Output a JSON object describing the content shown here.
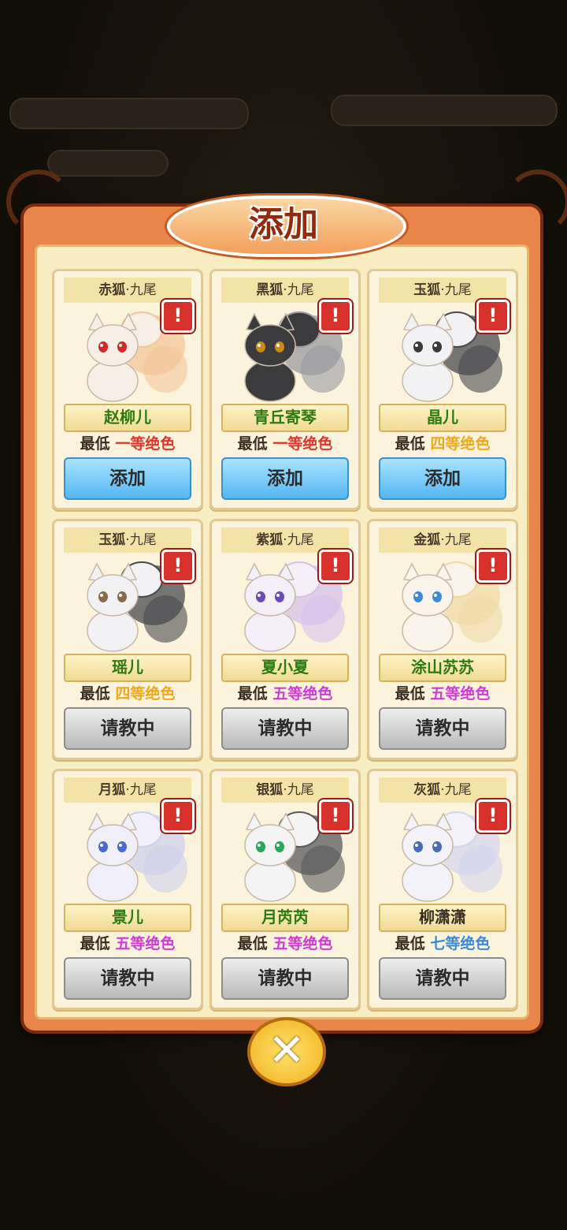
{
  "dialog": {
    "title": "添加"
  },
  "cards": [
    {
      "type_prefix": "赤狐",
      "type_suffix": "·九尾",
      "type_color": "#3a2e22",
      "name": "赵柳儿",
      "name_color": "#2e7a12",
      "req_prefix": "最低",
      "req_rank": "一等绝色",
      "req_color": "#e2342a",
      "button": "添加",
      "button_state": "add",
      "fur": "#f7eee6",
      "accent": "#f3c79a",
      "eye": "#d12a2a"
    },
    {
      "type_prefix": "黑狐",
      "type_suffix": "·九尾",
      "type_color": "#3a2e22",
      "name": "青丘寄琴",
      "name_color": "#2e7a12",
      "req_prefix": "最低",
      "req_rank": "一等绝色",
      "req_color": "#e2342a",
      "button": "添加",
      "button_state": "add",
      "fur": "#3b3b3e",
      "accent": "#9a9aa0",
      "eye": "#c98a1a"
    },
    {
      "type_prefix": "玉狐",
      "type_suffix": "·九尾",
      "type_color": "#3a2e22",
      "name": "晶儿",
      "name_color": "#2e7a12",
      "req_prefix": "最低",
      "req_rank": "四等绝色",
      "req_color": "#f0a81a",
      "button": "添加",
      "button_state": "add",
      "fur": "#f2f2f4",
      "accent": "#4a4a4e",
      "eye": "#3a3a3a"
    },
    {
      "type_prefix": "玉狐",
      "type_suffix": "·九尾",
      "type_color": "#3a2e22",
      "name": "瑶儿",
      "name_color": "#2e7a12",
      "req_prefix": "最低",
      "req_rank": "四等绝色",
      "req_color": "#f0a81a",
      "button": "请教中",
      "button_state": "busy",
      "fur": "#f2f2f4",
      "accent": "#4a4a4e",
      "eye": "#8a6a4a"
    },
    {
      "type_prefix": "紫狐",
      "type_suffix": "·九尾",
      "type_color": "#3a2e22",
      "name": "夏小夏",
      "name_color": "#2e7a12",
      "req_prefix": "最低",
      "req_rank": "五等绝色",
      "req_color": "#d23ad6",
      "button": "请教中",
      "button_state": "busy",
      "fur": "#f5effa",
      "accent": "#d7c2ee",
      "eye": "#6a4ab8"
    },
    {
      "type_prefix": "金狐",
      "type_suffix": "·九尾",
      "type_color": "#3a2e22",
      "name": "涂山苏苏",
      "name_color": "#2e7a12",
      "req_prefix": "最低",
      "req_rank": "五等绝色",
      "req_color": "#d23ad6",
      "button": "请教中",
      "button_state": "busy",
      "fur": "#fbf4ea",
      "accent": "#f0d9a6",
      "eye": "#3a8ad8"
    },
    {
      "type_prefix": "月狐",
      "type_suffix": "·九尾",
      "type_color": "#3a2e22",
      "name": "景儿",
      "name_color": "#2e7a12",
      "req_prefix": "最低",
      "req_rank": "五等绝色",
      "req_color": "#d23ad6",
      "button": "请教中",
      "button_state": "busy",
      "fur": "#f1f0fa",
      "accent": "#cfd0ee",
      "eye": "#4a6ad0"
    },
    {
      "type_prefix": "银狐",
      "type_suffix": "·九尾",
      "type_color": "#3a2e22",
      "name": "月芮芮",
      "name_color": "#2e7a12",
      "req_prefix": "最低",
      "req_rank": "五等绝色",
      "req_color": "#d23ad6",
      "button": "请教中",
      "button_state": "busy",
      "fur": "#f4f4f4",
      "accent": "#5a5a5e",
      "eye": "#2aa85a"
    },
    {
      "type_prefix": "灰狐",
      "type_suffix": "·九尾",
      "type_color": "#3a2e22",
      "name": "柳潇潇",
      "name_color": "#3a2e22",
      "req_prefix": "最低",
      "req_rank": "七等绝色",
      "req_color": "#3a8ad8",
      "button": "请教中",
      "button_state": "busy",
      "fur": "#f2f2f8",
      "accent": "#d4d6ee",
      "eye": "#4a6ab8"
    }
  ],
  "close": {
    "icon": "close-icon",
    "glyph": "✕"
  },
  "colors": {
    "panel_frame": "#e9844a",
    "panel_bg": "#f9edc4",
    "add_button": "#55b6f2",
    "busy_button": "#b9b9b9"
  }
}
